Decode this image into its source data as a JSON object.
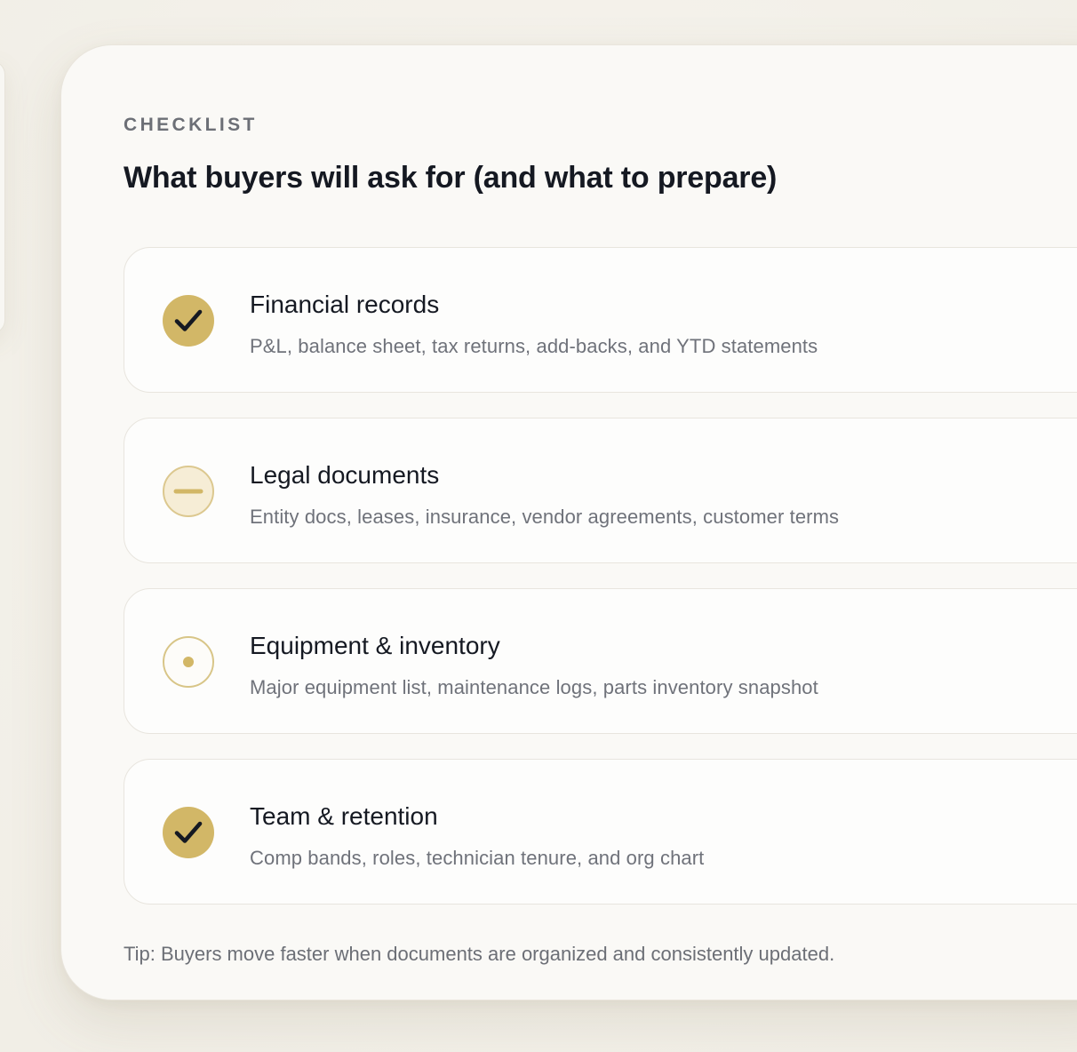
{
  "checklist": {
    "eyebrow": "CHECKLIST",
    "title": "What buyers will ask for (and what to prepare)",
    "items": [
      {
        "status": "done",
        "status_icon": "check-icon",
        "title": "Financial records",
        "description": "P&L, balance sheet, tax returns, add-backs, and YTD statements"
      },
      {
        "status": "in-progress",
        "status_icon": "minus-icon",
        "title": "Legal documents",
        "description": "Entity docs, leases, insurance, vendor agreements, customer terms"
      },
      {
        "status": "not-started",
        "status_icon": "dot-icon",
        "title": "Equipment & inventory",
        "description": "Major equipment list, maintenance logs, parts inventory snapshot"
      },
      {
        "status": "done",
        "status_icon": "check-icon",
        "title": "Team & retention",
        "description": "Comp bands, roles, technician tenure, and org chart"
      }
    ],
    "tip": "Tip: Buyers move faster when documents are organized and consistently updated."
  },
  "colors": {
    "accent_gold": "#d2b767",
    "accent_gold_light": "#f6edd6",
    "text_primary": "#151922",
    "text_secondary": "#6f727a",
    "panel_bg": "#faf9f6",
    "page_bg": "#f3f0e9"
  }
}
